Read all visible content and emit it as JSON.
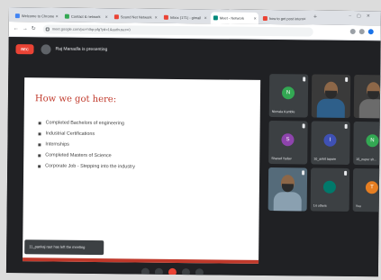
{
  "browser": {
    "tabs": [
      {
        "label": "Welcome to Chrome",
        "color": "#4285f4"
      },
      {
        "label": "Contact & network",
        "color": "#34a853"
      },
      {
        "label": "Sound Net Network",
        "color": "#ea4335"
      },
      {
        "label": "Inbox (171) - gimail",
        "color": "#ea4335"
      },
      {
        "label": "Meet - Network",
        "color": "#00897b"
      },
      {
        "label": "how to get post intern",
        "color": "#ea4335"
      }
    ],
    "active_tab_index": 4,
    "url": "meet.google.com/pcr-hthp-pfg?pli=1&authuser=0"
  },
  "meet": {
    "rec_label": "REC",
    "presenting_text": "Raj Manadla is presenting",
    "slide": {
      "title": "How we got here:",
      "bullets": [
        "Completed Bachelors of engineering",
        "Industrial Certifications",
        "Internships",
        "Completed Masters of Science",
        "Corporate Job - Stepping into the industry"
      ]
    },
    "toast": "11_pankaj raut has left the meeting",
    "participants": [
      {
        "name": "Nirmala Kamble",
        "initial": "N",
        "color": "#33a853",
        "photo": false
      },
      {
        "name": "",
        "initial": "",
        "color": "#3a3a3a",
        "photo": true,
        "shirt": "#2e5f8a"
      },
      {
        "name": "",
        "initial": "",
        "color": "#3a3a3a",
        "photo": true,
        "shirt": "#6b6b6b"
      },
      {
        "name": "Sharad Yadav",
        "initial": "S",
        "color": "#8e44ad",
        "photo": false
      },
      {
        "name": "10_ankit tapare",
        "initial": "I",
        "color": "#3f51b5",
        "photo": false
      },
      {
        "name": "15_nupur sh...",
        "initial": "N",
        "color": "#33a853",
        "photo": false
      },
      {
        "name": "",
        "initial": "",
        "color": "#556b7a",
        "photo": true,
        "shirt": "#8aa0b0"
      },
      {
        "name": "14 others",
        "initial": "",
        "color": "#00796b",
        "photo": false
      },
      {
        "name": "You",
        "initial": "T",
        "color": "#e67e22",
        "photo": false
      }
    ],
    "control_colors": [
      "#3c4043",
      "#3c4043",
      "#ea4335",
      "#3c4043",
      "#3c4043"
    ]
  }
}
